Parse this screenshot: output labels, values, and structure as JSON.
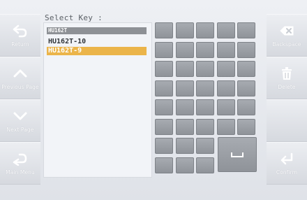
{
  "title": "Select Key :",
  "input_value": "HU162T",
  "keys": [
    {
      "label": "HU162T-10",
      "selected": false
    },
    {
      "label": "HU162T-9",
      "selected": true
    }
  ],
  "left_buttons": [
    {
      "name": "return-button",
      "icon": "return-arrow-icon",
      "label": "Return"
    },
    {
      "name": "previous-page-button",
      "icon": "chevron-up-icon",
      "label": "Previous Page"
    },
    {
      "name": "next-page-button",
      "icon": "chevron-down-icon",
      "label": "Next Page"
    },
    {
      "name": "main-menu-button",
      "icon": "main-menu-arrow-icon",
      "label": "Main Menu"
    }
  ],
  "right_buttons": [
    {
      "name": "backspace-button",
      "icon": "backspace-icon",
      "label": "Backspace"
    },
    {
      "name": "delete-button",
      "icon": "trash-icon",
      "label": "Delete"
    },
    {
      "name": "blank-button",
      "icon": "",
      "label": ""
    },
    {
      "name": "confirm-button",
      "icon": "enter-arrow-icon",
      "label": "Confirm"
    }
  ],
  "space_key_icon": "space-icon"
}
